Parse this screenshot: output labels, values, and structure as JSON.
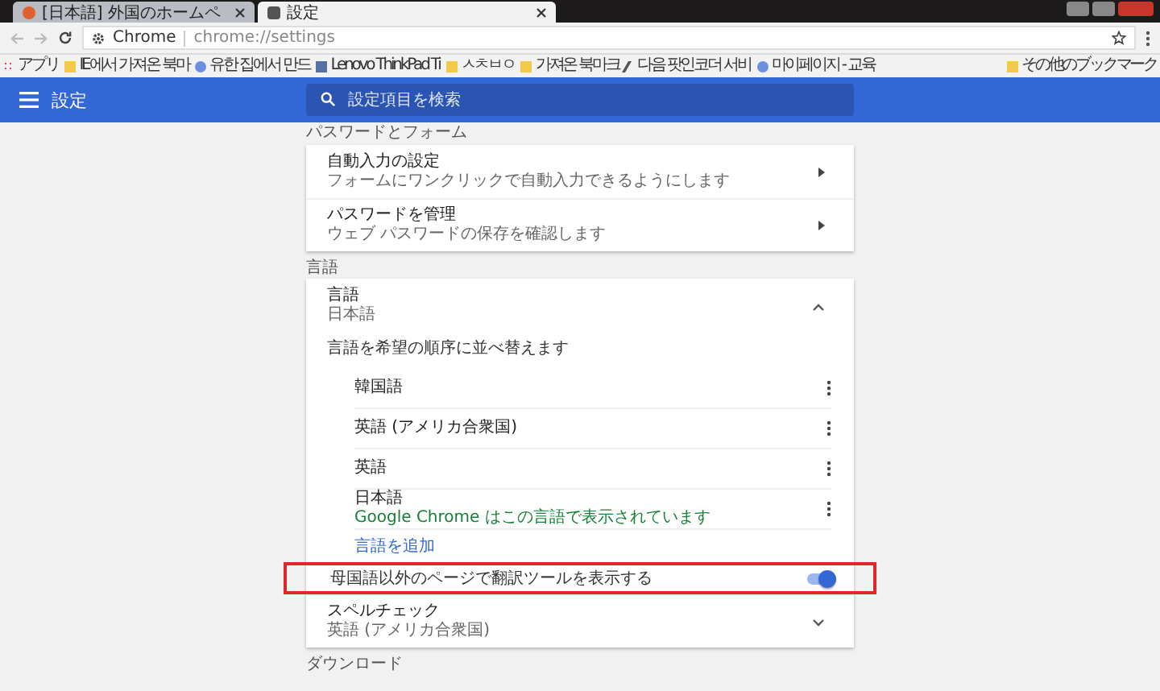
{
  "tabs": [
    {
      "label": "[日本語] 外国のホームペ",
      "selected": false
    },
    {
      "label": "設定",
      "selected": true
    }
  ],
  "address": {
    "site": "Chrome",
    "url": "chrome://settings"
  },
  "bookmarks": [
    {
      "label": "アプリ",
      "kind": "apps"
    },
    {
      "label": "IE에서 가져온 북마",
      "kind": "folder"
    },
    {
      "label": "유한 집에서 만드",
      "kind": "globe"
    },
    {
      "label": "Lenovo ThinkPad Ti",
      "kind": "page"
    },
    {
      "label": "ㅅㅊㅂㅇ",
      "kind": "folder"
    },
    {
      "label": "가져온 북마크",
      "kind": "folder"
    },
    {
      "label": "다음 팟인코더 서비",
      "kind": "pen"
    },
    {
      "label": "마이페이지 - 교육",
      "kind": "globe"
    }
  ],
  "other_bookmarks": "その他のブックマーク",
  "header": {
    "title": "設定",
    "search_placeholder": "設定項目を検索"
  },
  "sections": [
    {
      "heading": "パスワードとフォーム",
      "kind": "links",
      "rows": [
        {
          "title": "自動入力の設定",
          "subtitle": "フォームにワンクリックで自動入力できるようにします"
        },
        {
          "title": "パスワードを管理",
          "subtitle": "ウェブ パスワードの保存を確認します"
        }
      ]
    },
    {
      "heading": "言語",
      "kind": "languages",
      "title": "言語",
      "subtitle": "日本語",
      "expanded": true,
      "order_label": "言語を希望の順序に並べ替えます",
      "languages": [
        {
          "name": "韓国語"
        },
        {
          "name": "英語 (アメリカ合衆国)"
        },
        {
          "name": "英語"
        },
        {
          "name": "日本語",
          "note": "Google Chrome はこの言語で表示されています"
        }
      ],
      "add_link": "言語を追加",
      "translate": {
        "label": "母国語以外のページで翻訳ツールを表示する",
        "on": true,
        "highlighted": true
      },
      "spellcheck": {
        "title": "スペルチェック",
        "subtitle": "英語 (アメリカ合衆国)",
        "expanded": false
      }
    },
    {
      "heading": "ダウンロード",
      "kind": "heading"
    }
  ]
}
